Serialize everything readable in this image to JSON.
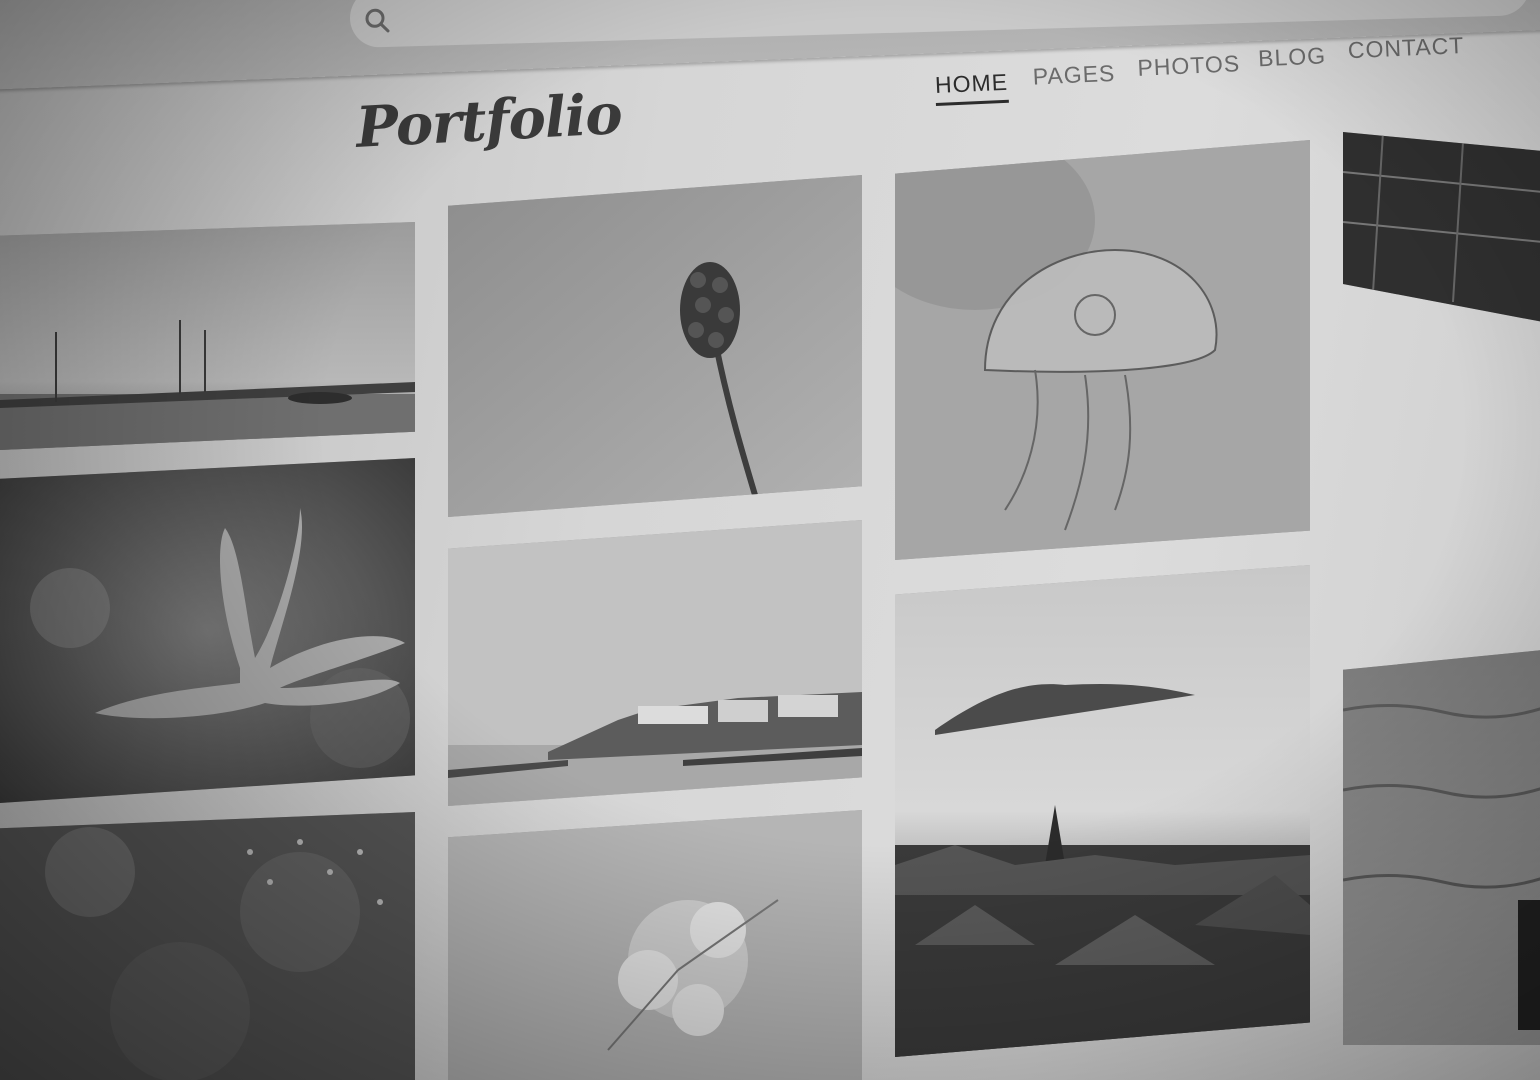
{
  "site": {
    "logo": "Portfolio"
  },
  "nav": {
    "items": [
      "HOME",
      "PAGES",
      "PHOTOS",
      "BLOG",
      "CONTACT"
    ],
    "active": "HOME"
  },
  "icons": {
    "search": "search-icon"
  },
  "photos": [
    {
      "subject": "sailboats-harbor"
    },
    {
      "subject": "grape-hyacinth-flower"
    },
    {
      "subject": "jellyfish"
    },
    {
      "subject": "harbor-edge"
    },
    {
      "subject": "starfish-flower"
    },
    {
      "subject": "coastal-town"
    },
    {
      "subject": "foggy-mountain-village"
    },
    {
      "subject": "water-drops"
    },
    {
      "subject": "cherry-blossom"
    },
    {
      "subject": "sea-waves"
    }
  ],
  "colors": {
    "text_dark": "#2c2c2c",
    "text_muted": "#6b6b6b",
    "page_bg": "#d6d6d6"
  }
}
